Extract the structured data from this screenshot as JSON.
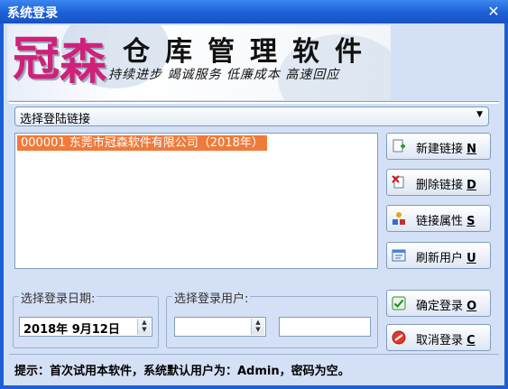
{
  "window": {
    "title": "系统登录",
    "close_glyph": "✕"
  },
  "banner": {
    "logo_chars": [
      "冠",
      "森"
    ],
    "product_chars": [
      "仓",
      "库",
      "管",
      "理",
      "软",
      "件"
    ],
    "slogan": "持续进步 竭诚服务 低廉成本 高速回应"
  },
  "connection_combo": {
    "value": "选择登陆链接",
    "arrow_glyph": "▼"
  },
  "connection_list": {
    "items": [
      "000001 东莞市冠森软件有限公司（2018年）"
    ]
  },
  "side_buttons": [
    {
      "label": "新建链接",
      "key": "N",
      "icon": "new-link-icon"
    },
    {
      "label": "删除链接",
      "key": "D",
      "icon": "delete-link-icon"
    },
    {
      "label": "链接属性",
      "key": "S",
      "icon": "properties-icon"
    },
    {
      "label": "刷新用户",
      "key": "U",
      "icon": "refresh-users-icon"
    }
  ],
  "date_group": {
    "label": "选择登录日期:",
    "value": "2018年  9月12日"
  },
  "user_group": {
    "label": "选择登录用户:",
    "user_value": "",
    "password_value": ""
  },
  "action_buttons": [
    {
      "label": "确定登录",
      "key": "O",
      "icon": "confirm-icon"
    },
    {
      "label": "取消登录",
      "key": "C",
      "icon": "cancel-icon"
    }
  ],
  "hint": "提示：首次试用本软件，系统默认用户为：Admin，密码为空。",
  "colors": {
    "title_bar": "#1c5fd6",
    "selection": "#f07a3a",
    "client_bg": "#d4e0f5",
    "logo": "#d0217a"
  }
}
